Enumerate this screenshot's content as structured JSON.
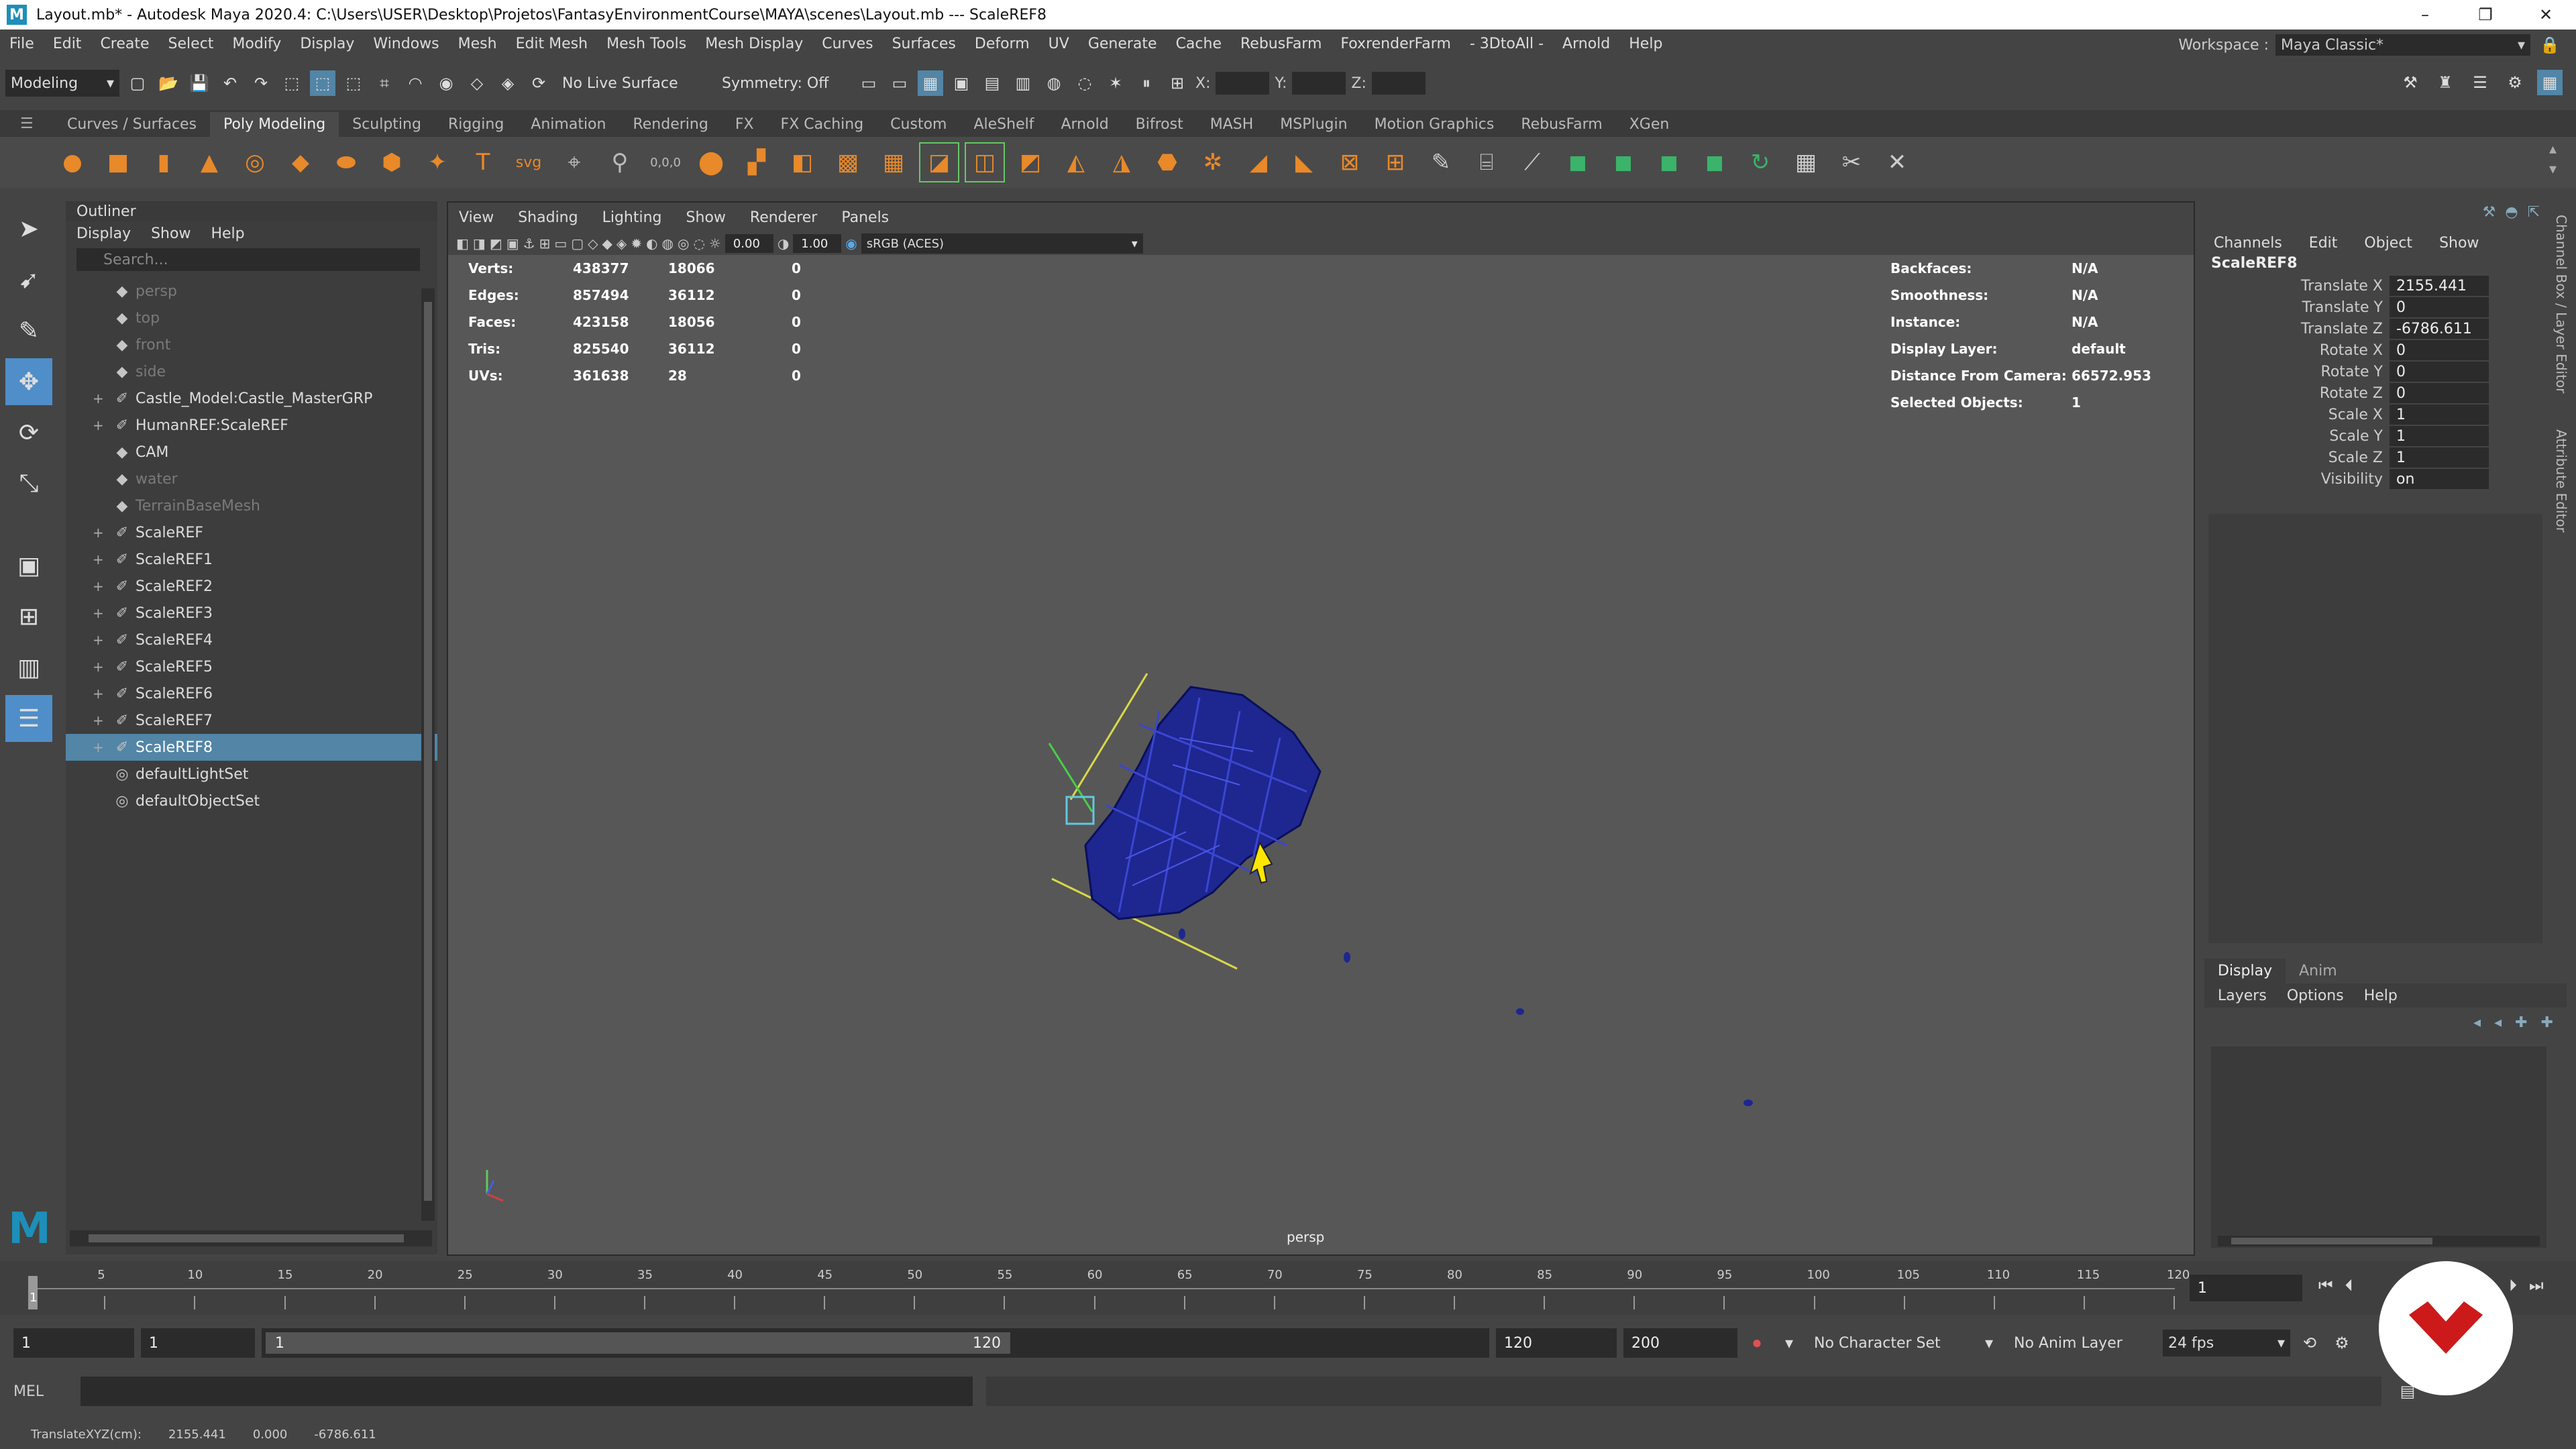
{
  "title_bar": {
    "title": "Layout.mb* - Autodesk Maya 2020.4: C:\\Users\\USER\\Desktop\\Projetos\\FantasyEnvironmentCourse\\MAYA\\scenes\\Layout.mb  ---  ScaleREF8",
    "logo": "M"
  },
  "menu": [
    "File",
    "Edit",
    "Create",
    "Select",
    "Modify",
    "Display",
    "Windows",
    "Mesh",
    "Edit Mesh",
    "Mesh Tools",
    "Mesh Display",
    "Curves",
    "Surfaces",
    "Deform",
    "UV",
    "Generate",
    "Cache",
    "RebusFarm",
    "FoxrenderFarm",
    "- 3DtoAll -",
    "Arnold",
    "Help"
  ],
  "workspace": {
    "label": "Workspace :",
    "value": "Maya Classic*"
  },
  "status_line": {
    "mode": "Modeling",
    "live_surface": "No Live Surface",
    "symmetry": "Symmetry: Off",
    "x_label": "X:",
    "y_label": "Y:",
    "z_label": "Z:"
  },
  "shelf_tabs": [
    "Curves / Surfaces",
    "Poly Modeling",
    "Sculpting",
    "Rigging",
    "Animation",
    "Rendering",
    "FX",
    "FX Caching",
    "Custom",
    "AleShelf",
    "Arnold",
    "Bifrost",
    "MASH",
    "MSPlugin",
    "Motion Graphics",
    "RebusFarm",
    "XGen"
  ],
  "active_shelf_tab": "Poly Modeling",
  "shelf_text_icons": {
    "text_tool": "T",
    "svg_tool": "svg",
    "coords_tool": "0,0,0"
  },
  "outliner": {
    "title": "Outliner",
    "menu": [
      "Display",
      "Show",
      "Help"
    ],
    "search_placeholder": "Search...",
    "items": [
      {
        "label": "persp",
        "dim": true,
        "expand": ""
      },
      {
        "label": "top",
        "dim": true,
        "expand": ""
      },
      {
        "label": "front",
        "dim": true,
        "expand": ""
      },
      {
        "label": "side",
        "dim": true,
        "expand": ""
      },
      {
        "label": "Castle_Model:Castle_MasterGRP",
        "dim": false,
        "expand": "+"
      },
      {
        "label": "HumanREF:ScaleREF",
        "dim": false,
        "expand": "+"
      },
      {
        "label": "CAM",
        "dim": false,
        "expand": ""
      },
      {
        "label": "water",
        "dim": true,
        "expand": ""
      },
      {
        "label": "TerrainBaseMesh",
        "dim": true,
        "expand": ""
      },
      {
        "label": "ScaleREF",
        "dim": false,
        "expand": "+"
      },
      {
        "label": "ScaleREF1",
        "dim": false,
        "expand": "+"
      },
      {
        "label": "ScaleREF2",
        "dim": false,
        "expand": "+"
      },
      {
        "label": "ScaleREF3",
        "dim": false,
        "expand": "+"
      },
      {
        "label": "ScaleREF4",
        "dim": false,
        "expand": "+"
      },
      {
        "label": "ScaleREF5",
        "dim": false,
        "expand": "+"
      },
      {
        "label": "ScaleREF6",
        "dim": false,
        "expand": "+"
      },
      {
        "label": "ScaleREF7",
        "dim": false,
        "expand": "+"
      },
      {
        "label": "ScaleREF8",
        "dim": false,
        "expand": "+",
        "selected": true
      },
      {
        "label": "defaultLightSet",
        "dim": false,
        "expand": ""
      },
      {
        "label": "defaultObjectSet",
        "dim": false,
        "expand": ""
      }
    ]
  },
  "viewport": {
    "menu": [
      "View",
      "Shading",
      "Lighting",
      "Show",
      "Renderer",
      "Panels"
    ],
    "exposure": "0.00",
    "gamma": "1.00",
    "color_space": "sRGB (ACES)",
    "camera_label": "persp",
    "hud_left": [
      {
        "label": "Verts:",
        "a": "438377",
        "b": "18066",
        "c": "0"
      },
      {
        "label": "Edges:",
        "a": "857494",
        "b": "36112",
        "c": "0"
      },
      {
        "label": "Faces:",
        "a": "423158",
        "b": "18056",
        "c": "0"
      },
      {
        "label": "Tris:",
        "a": "825540",
        "b": "36112",
        "c": "0"
      },
      {
        "label": "UVs:",
        "a": "361638",
        "b": "28",
        "c": "0"
      }
    ],
    "hud_right": [
      {
        "label": "Backfaces:",
        "value": "N/A"
      },
      {
        "label": "Smoothness:",
        "value": "N/A"
      },
      {
        "label": "Instance:",
        "value": "N/A"
      },
      {
        "label": "Display Layer:",
        "value": "default"
      },
      {
        "label": "Distance From Camera:",
        "value": "66572.953"
      },
      {
        "label": "Selected Objects:",
        "value": "1"
      }
    ]
  },
  "channel_box": {
    "menu": [
      "Channels",
      "Edit",
      "Object",
      "Show"
    ],
    "object": "ScaleREF8",
    "attributes": [
      {
        "label": "Translate X",
        "value": "2155.441"
      },
      {
        "label": "Translate Y",
        "value": "0"
      },
      {
        "label": "Translate Z",
        "value": "-6786.611"
      },
      {
        "label": "Rotate X",
        "value": "0"
      },
      {
        "label": "Rotate Y",
        "value": "0"
      },
      {
        "label": "Rotate Z",
        "value": "0"
      },
      {
        "label": "Scale X",
        "value": "1"
      },
      {
        "label": "Scale Y",
        "value": "1"
      },
      {
        "label": "Scale Z",
        "value": "1"
      },
      {
        "label": "Visibility",
        "value": "on"
      }
    ],
    "side_tabs": [
      "Channel Box / Layer Editor",
      "Attribute Editor"
    ]
  },
  "layer_editor": {
    "tabs": [
      "Display",
      "Anim"
    ],
    "menu": [
      "Layers",
      "Options",
      "Help"
    ]
  },
  "timeline": {
    "ticks": [
      "5",
      "10",
      "15",
      "20",
      "25",
      "30",
      "35",
      "40",
      "45",
      "50",
      "55",
      "60",
      "65",
      "70",
      "75",
      "80",
      "85",
      "90",
      "95",
      "100",
      "105",
      "110",
      "115",
      "120"
    ],
    "current_frame": "1",
    "current_frame_field": "1"
  },
  "range_slider": {
    "start": "1",
    "anim_start": "1",
    "range_start": "1",
    "range_end": "120",
    "anim_end": "120",
    "end": "200",
    "character_set": "No Character Set",
    "anim_layer": "No Anim Layer",
    "fps": "24 fps"
  },
  "command_line": {
    "label": "MEL"
  },
  "help_line": {
    "label": "TranslateXYZ(cm):",
    "x": "2155.441",
    "y": "0.000",
    "z": "-6786.611"
  }
}
